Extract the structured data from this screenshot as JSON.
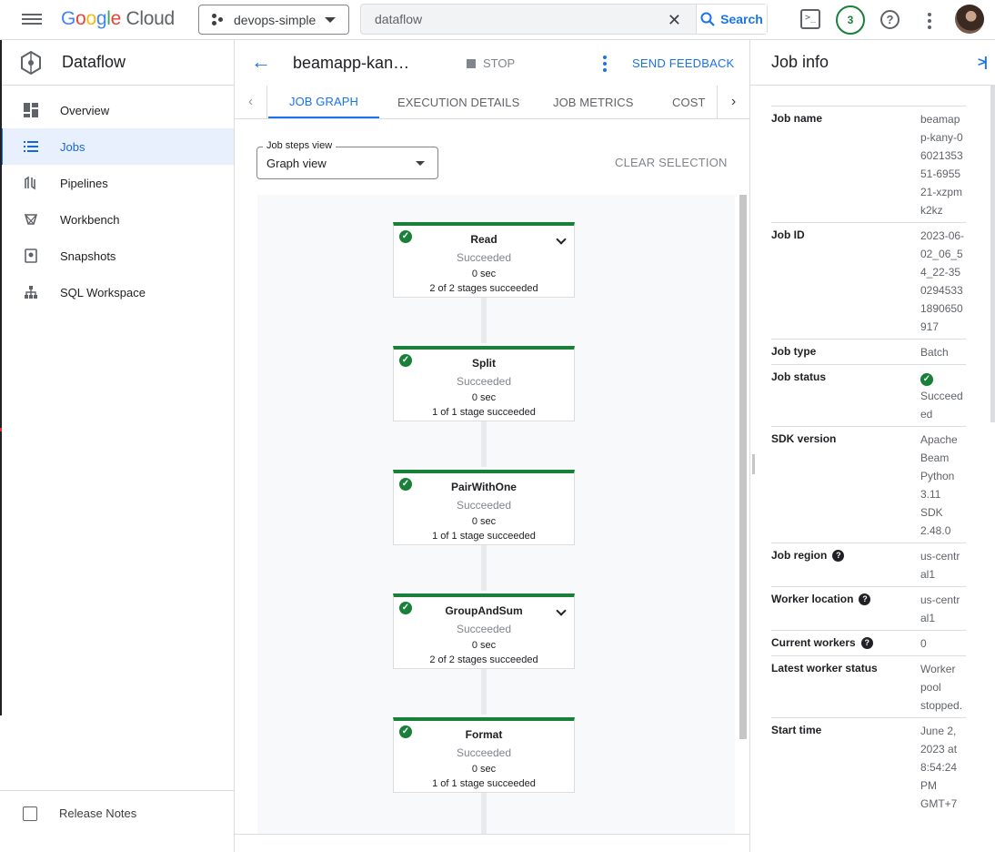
{
  "topbar": {
    "logo_google": "Google",
    "logo_cloud": "Cloud",
    "project": "devops-simple",
    "search_value": "dataflow",
    "search_button": "Search",
    "notifications_count": "3",
    "terminal_icon_glyph": ">_",
    "help_glyph": "?",
    "clear_glyph": "✕"
  },
  "sidebar": {
    "product": "Dataflow",
    "items": [
      {
        "label": "Overview",
        "icon": "dashboard-icon"
      },
      {
        "label": "Jobs",
        "icon": "list-icon",
        "active": true
      },
      {
        "label": "Pipelines",
        "icon": "pipelines-icon"
      },
      {
        "label": "Workbench",
        "icon": "workbench-icon"
      },
      {
        "label": "Snapshots",
        "icon": "snapshot-icon"
      },
      {
        "label": "SQL Workspace",
        "icon": "hierarchy-icon"
      }
    ],
    "release_notes": "Release Notes"
  },
  "header": {
    "back_glyph": "←",
    "job_title": "beamapp-kan…",
    "stop": "STOP",
    "send_feedback": "SEND FEEDBACK"
  },
  "tabs": {
    "items": [
      "JOB GRAPH",
      "EXECUTION DETAILS",
      "JOB METRICS",
      "COST"
    ],
    "active": "JOB GRAPH",
    "left_arrow": "‹",
    "right_arrow": "›"
  },
  "controls": {
    "steps_view_label": "Job steps view",
    "steps_view_value": "Graph view",
    "clear_selection": "CLEAR SELECTION"
  },
  "graph": {
    "check_glyph": "✓",
    "nodes": [
      {
        "name": "Read",
        "status": "Succeeded",
        "time": "0 sec",
        "stages": "2 of 2 stages succeeded",
        "expandable": true
      },
      {
        "name": "Split",
        "status": "Succeeded",
        "time": "0 sec",
        "stages": "1 of 1 stage succeeded",
        "expandable": false
      },
      {
        "name": "PairWithOne",
        "status": "Succeeded",
        "time": "0 sec",
        "stages": "1 of 1 stage succeeded",
        "expandable": false
      },
      {
        "name": "GroupAndSum",
        "status": "Succeeded",
        "time": "0 sec",
        "stages": "2 of 2 stages succeeded",
        "expandable": true
      },
      {
        "name": "Format",
        "status": "Succeeded",
        "time": "0 sec",
        "stages": "1 of 1 stage succeeded",
        "expandable": false
      }
    ]
  },
  "job_info": {
    "title": "Job info",
    "collapse_glyph": ">|",
    "rows": [
      {
        "key": "Job name",
        "value": "beamapp-kany-0602135351-695521-xzpmk2kz"
      },
      {
        "key": "Job ID",
        "value": "2023-06-02_06_54_22-3502945331890650917"
      },
      {
        "key": "Job type",
        "value": "Batch"
      },
      {
        "key": "Job status",
        "value": "Succeeded",
        "status_icon": true
      },
      {
        "key": "SDK version",
        "value": "Apache Beam Python 3.11 SDK 2.48.0"
      },
      {
        "key": "Job region",
        "value": "us-central1",
        "help": true
      },
      {
        "key": "Worker location",
        "value": "us-central1",
        "help": true
      },
      {
        "key": "Current workers",
        "value": "0",
        "help": true
      },
      {
        "key": "Latest worker status",
        "value": "Worker pool stopped."
      },
      {
        "key": "Start time",
        "value": "June 2, 2023 at 8:54:24 PM GMT+7"
      }
    ]
  },
  "colors": {
    "accent": "#1a73e8",
    "success": "#188038",
    "active_bg": "#e8f0fe"
  }
}
